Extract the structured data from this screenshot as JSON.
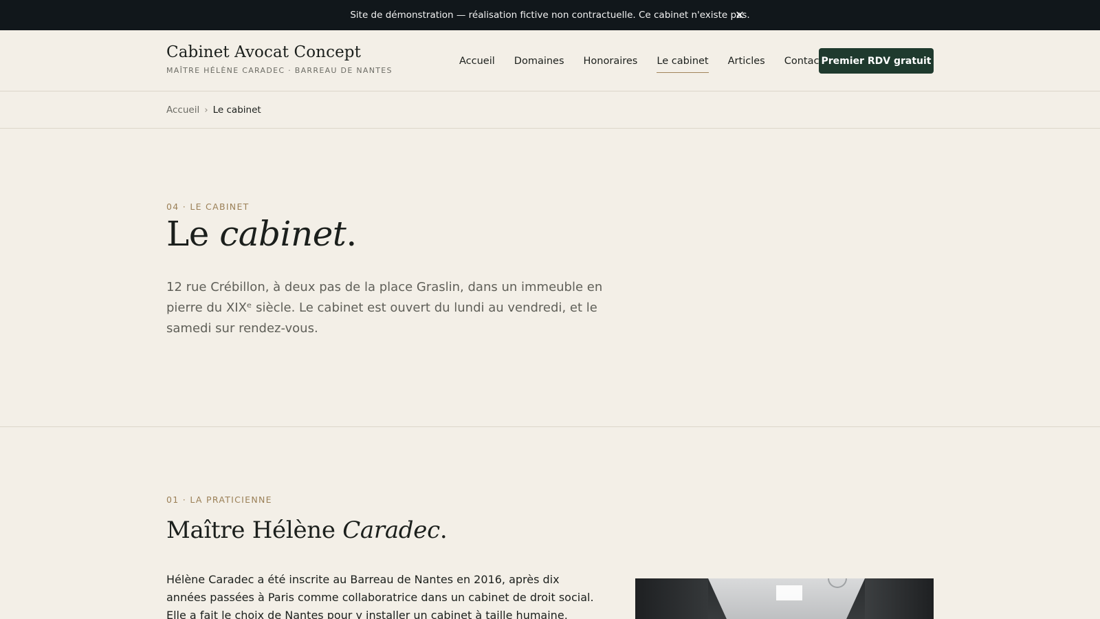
{
  "banner": {
    "text": "Site de démonstration — réalisation fictive non contractuelle. Ce cabinet n'existe pas.",
    "close_label": "×"
  },
  "brand": {
    "name": "Cabinet Avocat Concept",
    "subtitle": "MAÎTRE HÉLÈNE CARADEC · BARREAU DE NANTES"
  },
  "nav": {
    "items": [
      "Accueil",
      "Domaines",
      "Honoraires",
      "Le cabinet",
      "Articles",
      "Contact"
    ],
    "active": "Le cabinet",
    "cta_label": "Premier RDV gratuit"
  },
  "breadcrumb": {
    "home": "Accueil",
    "separator": "›",
    "current": "Le cabinet"
  },
  "hero": {
    "eyebrow": "04 · LE CABINET",
    "title_plain": "Le ",
    "title_italic": "cabinet",
    "title_end": ".",
    "lead": "12 rue Crébillon, à deux pas de la place Graslin, dans un immeuble en pierre du XIXᵉ siècle. Le cabinet est ouvert du lundi au vendredi, et le samedi sur rendez-vous."
  },
  "practitioner": {
    "eyebrow": "01 · LA PRATICIENNE",
    "title_plain": "Maître Hélène ",
    "title_italic": "Caradec",
    "title_end": ".",
    "body": "Hélène Caradec a été inscrite au Barreau de Nantes en 2016, après dix années passées à Paris comme collaboratrice dans un cabinet de droit social. Elle a fait le choix de Nantes pour y installer un cabinet à taille humaine, généraliste sur deux"
  },
  "colors": {
    "background": "#f3efe7",
    "banner": "#11171b",
    "accent_green": "#1f3a2e",
    "accent_gold": "#9a7f56"
  }
}
